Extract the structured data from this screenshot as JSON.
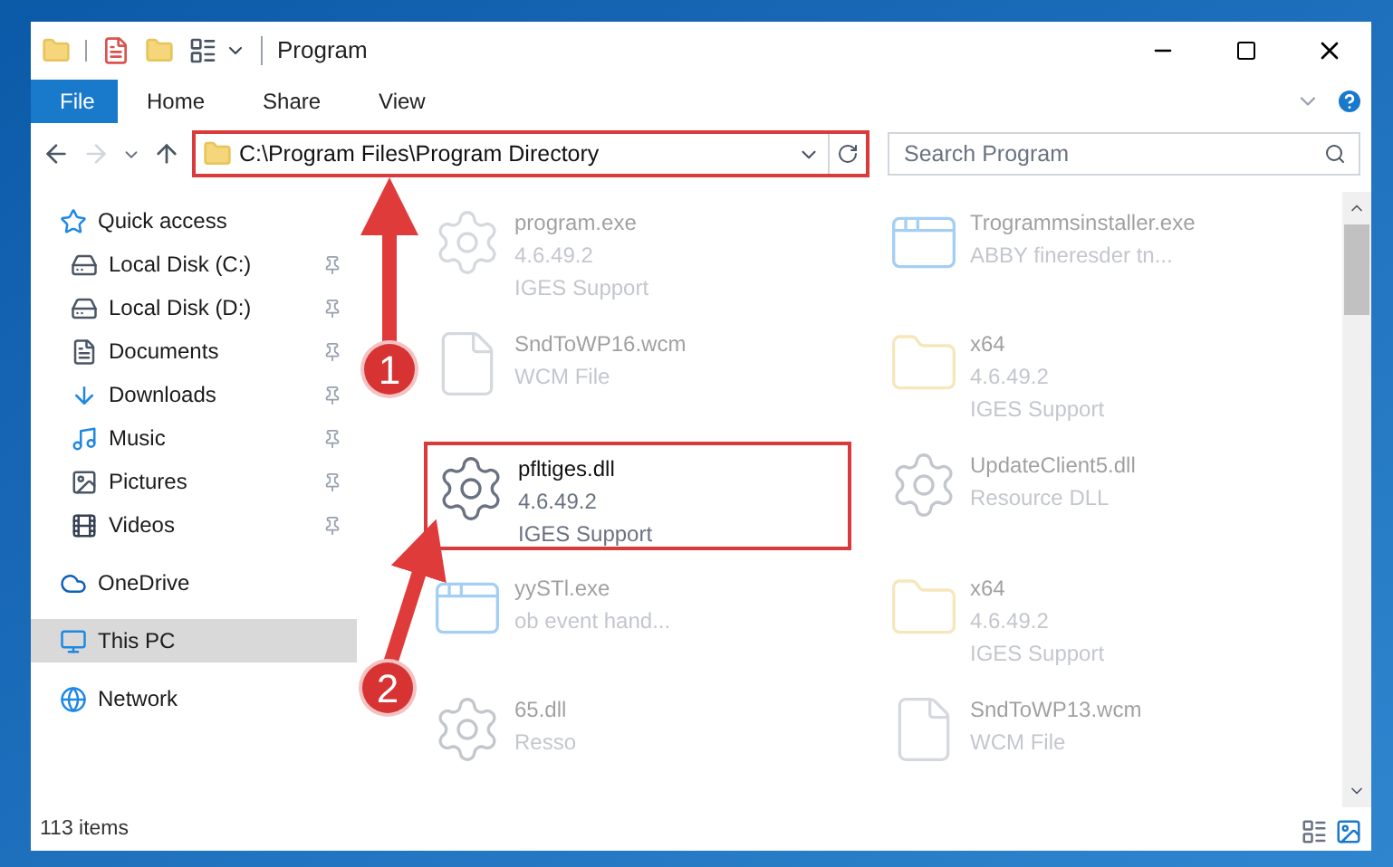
{
  "window": {
    "title": "Program"
  },
  "ribbon_tabs": [
    {
      "label": "File",
      "selected": true
    },
    {
      "label": "Home",
      "selected": false
    },
    {
      "label": "Share",
      "selected": false
    },
    {
      "label": "View",
      "selected": false
    }
  ],
  "address": {
    "path": "C:\\Program Files\\Program Directory",
    "highlighted": true
  },
  "search": {
    "placeholder": "Search Program"
  },
  "sidebar": {
    "items": [
      {
        "label": "Quick access",
        "kind": "star",
        "selected": false,
        "children": [
          {
            "label": "Local Disk (C:)",
            "kind": "disk",
            "pinned": true,
            "selected": false
          },
          {
            "label": "Local Disk (D:)",
            "kind": "disk",
            "pinned": true,
            "selected": false
          },
          {
            "label": "Documents",
            "kind": "doc",
            "pinned": true,
            "selected": false
          },
          {
            "label": "Downloads",
            "kind": "download",
            "pinned": true,
            "selected": false
          },
          {
            "label": "Music",
            "kind": "music",
            "pinned": true,
            "selected": false
          },
          {
            "label": "Pictures",
            "kind": "picture",
            "pinned": true,
            "selected": false
          },
          {
            "label": "Videos",
            "kind": "video",
            "pinned": true,
            "selected": false
          }
        ]
      },
      {
        "label": "OneDrive",
        "kind": "cloud",
        "selected": false
      },
      {
        "label": "This PC",
        "kind": "pc",
        "selected": true
      },
      {
        "label": "Network",
        "kind": "network",
        "selected": false
      }
    ]
  },
  "files": [
    {
      "name": "program.exe",
      "lines": [
        "4.6.49.2",
        "IGES Support"
      ],
      "kind": "exe",
      "faded": true,
      "highlighted": false
    },
    {
      "name": "Trogrammsinstaller.exe",
      "lines": [
        "ABBY fineresder tn..."
      ],
      "kind": "window",
      "faded": true,
      "highlighted": false
    },
    {
      "name": "SndToWP16.wcm",
      "lines": [
        "WCM File"
      ],
      "kind": "blank",
      "faded": true,
      "highlighted": false
    },
    {
      "name": "x64",
      "lines": [
        "4.6.49.2",
        "IGES Support"
      ],
      "kind": "folder",
      "faded": true,
      "highlighted": false
    },
    {
      "name": "pfltiges.dll",
      "lines": [
        "4.6.49.2",
        "IGES Support"
      ],
      "kind": "dll",
      "faded": false,
      "highlighted": true
    },
    {
      "name": "UpdateClient5.dll",
      "lines": [
        "Resource DLL"
      ],
      "kind": "dll",
      "faded": true,
      "highlighted": false
    },
    {
      "name": "yySTl.exe",
      "lines": [
        "ob event hand..."
      ],
      "kind": "window",
      "faded": true,
      "highlighted": false
    },
    {
      "name": "x64",
      "lines": [
        "4.6.49.2",
        "IGES Support"
      ],
      "kind": "folder",
      "faded": true,
      "highlighted": false
    },
    {
      "name": "65.dll",
      "lines": [
        "Resso"
      ],
      "kind": "dll",
      "faded": true,
      "highlighted": false
    },
    {
      "name": "SndToWP13.wcm",
      "lines": [
        "WCM File"
      ],
      "kind": "blank",
      "faded": true,
      "highlighted": false
    }
  ],
  "status_bar": {
    "count": "113 items"
  },
  "annotations": [
    {
      "number": "1"
    },
    {
      "number": "2"
    }
  ]
}
